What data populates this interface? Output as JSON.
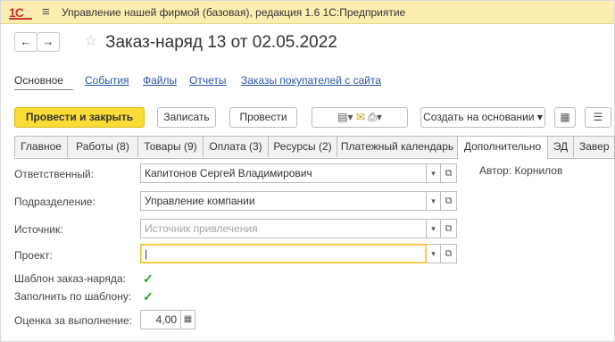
{
  "app": {
    "logo": "1С",
    "title": "Управление нашей фирмой (базовая), редакция 1.6 1С:Предприятие"
  },
  "nav": {
    "back_icon": "arrow-left-icon",
    "forward_icon": "arrow-right-icon",
    "back": "←",
    "forward": "→",
    "star": "☆",
    "doc_title": "Заказ-наряд 13 от 02.05.2022"
  },
  "sections": [
    {
      "label": "Основное",
      "active": true
    },
    {
      "label": "События",
      "active": false
    },
    {
      "label": "Файлы",
      "active": false
    },
    {
      "label": "Отчеты",
      "active": false
    },
    {
      "label": "Заказы покупателей с сайта",
      "active": false
    }
  ],
  "commands": {
    "post_close": "Провести и закрыть",
    "save": "Записать",
    "post": "Провести",
    "create_based_on": "Создать на основании ▾"
  },
  "tabs": [
    {
      "label": "Главное"
    },
    {
      "label": "Работы (8)"
    },
    {
      "label": "Товары (9)"
    },
    {
      "label": "Оплата (3)"
    },
    {
      "label": "Ресурсы (2)"
    },
    {
      "label": "Платежный календарь"
    },
    {
      "label": "Дополнительно"
    },
    {
      "label": "ЭД"
    },
    {
      "label": "Завер"
    }
  ],
  "form": {
    "responsible_label": "Ответственный:",
    "responsible_value": "Капитонов Сергей Владимирович",
    "author": "Автор: Корнилов",
    "department_label": "Подразделение:",
    "department_value": "Управление компании",
    "source_label": "Источник:",
    "source_placeholder": "Источник привлечения",
    "project_label": "Проект:",
    "project_value": "|",
    "template_label": "Шаблон заказ-наряда:",
    "template_checked": true,
    "fill_label": "Заполнить по шаблону:",
    "fill_checked": true,
    "estimate_label": "Оценка за выполнение:",
    "estimate_value": "4,00"
  },
  "colors": {
    "accent": "#fadc36",
    "titlebar": "#fbeeb0",
    "link": "#2a55a8",
    "check": "#2a9c2a"
  }
}
